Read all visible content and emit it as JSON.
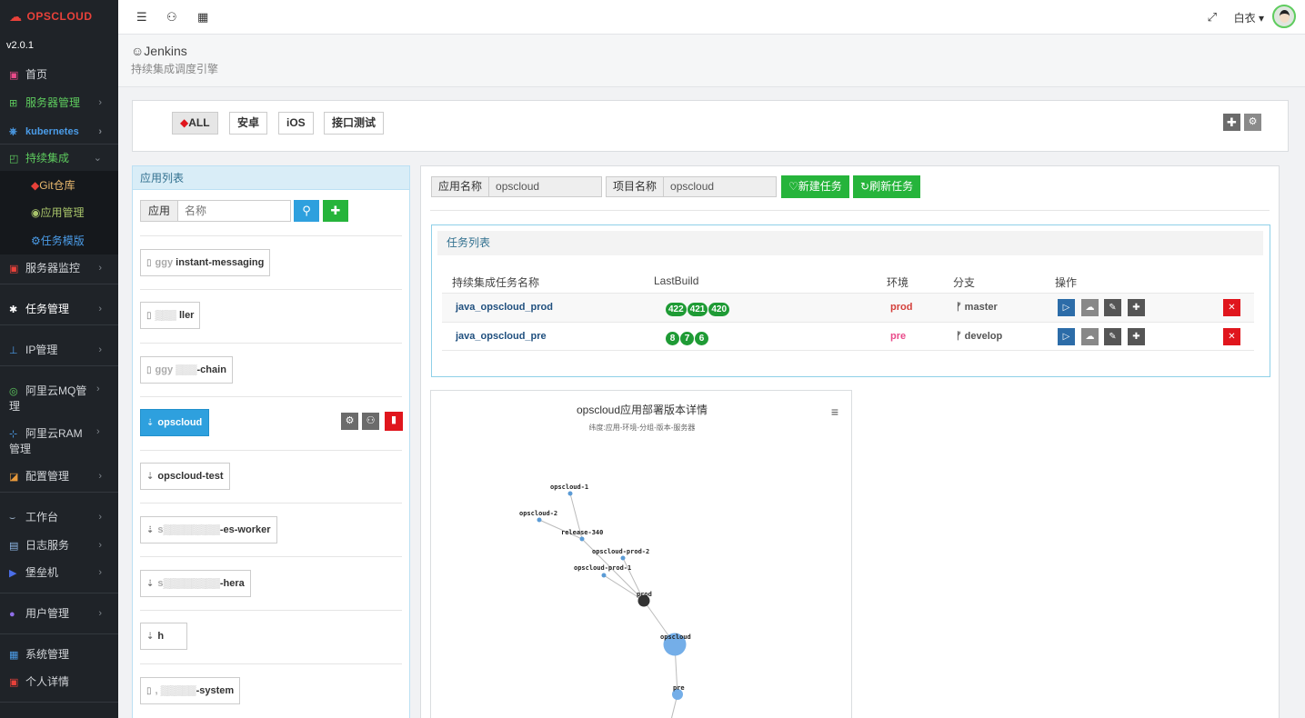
{
  "brand": {
    "name": "OPSCLOUD",
    "version": "v2.0.1"
  },
  "sidebar": {
    "items": [
      {
        "label": "首页",
        "icon": "dashboard-icon"
      },
      {
        "label": "服务器管理",
        "icon": "windows-icon"
      },
      {
        "label": "kubernetes",
        "icon": "helm-icon"
      },
      {
        "label": "持续集成",
        "icon": "ci-icon"
      },
      {
        "label": "Git仓库",
        "icon": "git-icon"
      },
      {
        "label": "应用管理",
        "icon": "app-icon"
      },
      {
        "label": "任务模版",
        "icon": "template-icon"
      },
      {
        "label": "服务器监控",
        "icon": "monitor-icon"
      },
      {
        "label": "任务管理",
        "icon": "task-icon"
      },
      {
        "label": "IP管理",
        "icon": "sitemap-icon"
      },
      {
        "label": "阿里云MQ管理",
        "icon": "mq-icon"
      },
      {
        "label": "阿里云RAM管理",
        "icon": "ram-icon"
      },
      {
        "label": "配置管理",
        "icon": "config-icon"
      },
      {
        "label": "工作台",
        "icon": "workbench-icon"
      },
      {
        "label": "日志服务",
        "icon": "log-icon"
      },
      {
        "label": "堡垒机",
        "icon": "terminal-icon"
      },
      {
        "label": "用户管理",
        "icon": "user-icon"
      },
      {
        "label": "系统管理",
        "icon": "grid-icon"
      },
      {
        "label": "个人详情",
        "icon": "profile-icon"
      }
    ]
  },
  "topbar": {
    "user": "白衣"
  },
  "page": {
    "title": "Jenkins",
    "subtitle": "持续集成调度引擎"
  },
  "tags": {
    "all": "ALL",
    "android": "安卓",
    "ios": "iOS",
    "api_test": "接口测试"
  },
  "applist": {
    "title": "应用列表",
    "search_label": "应用",
    "search_placeholder": "名称",
    "apps": [
      {
        "name": "instant-messaging"
      },
      {
        "name": "ller"
      },
      {
        "name": "-chain"
      },
      {
        "name": "opscloud"
      },
      {
        "name": "opscloud-test"
      },
      {
        "name": "-es-worker"
      },
      {
        "name": "-hera"
      },
      {
        "name": "h"
      },
      {
        "name": "-system"
      }
    ]
  },
  "detail": {
    "app_label": "应用名称",
    "app_value": "opscloud",
    "project_label": "项目名称",
    "project_value": "opscloud",
    "new_task": "新建任务",
    "refresh_task": "刷新任务"
  },
  "tasks": {
    "title": "任务列表",
    "columns": [
      "持续集成任务名称",
      "LastBuild",
      "环境",
      "分支",
      "操作"
    ],
    "rows": [
      {
        "name": "java_opscloud_prod",
        "builds": [
          "422",
          "421",
          "420"
        ],
        "env": "prod",
        "branch": "master"
      },
      {
        "name": "java_opscloud_pre",
        "builds": [
          "8",
          "7",
          "6"
        ],
        "env": "pre",
        "branch": "develop"
      }
    ]
  },
  "chart": {
    "title": "opscloud应用部署版本详情",
    "subtitle": "纬度:应用-环境-分组-版本-服务器",
    "nodes": [
      "opscloud-1",
      "opscloud-2",
      "release-340",
      "opscloud-prod-2",
      "opscloud-prod-1",
      "prod",
      "opscloud",
      "pre"
    ]
  },
  "colors": {
    "green": "#26b43b",
    "blue": "#2ea0de",
    "red": "#e0161d",
    "prod": "#d43f3a",
    "pre": "#e94b8a"
  }
}
